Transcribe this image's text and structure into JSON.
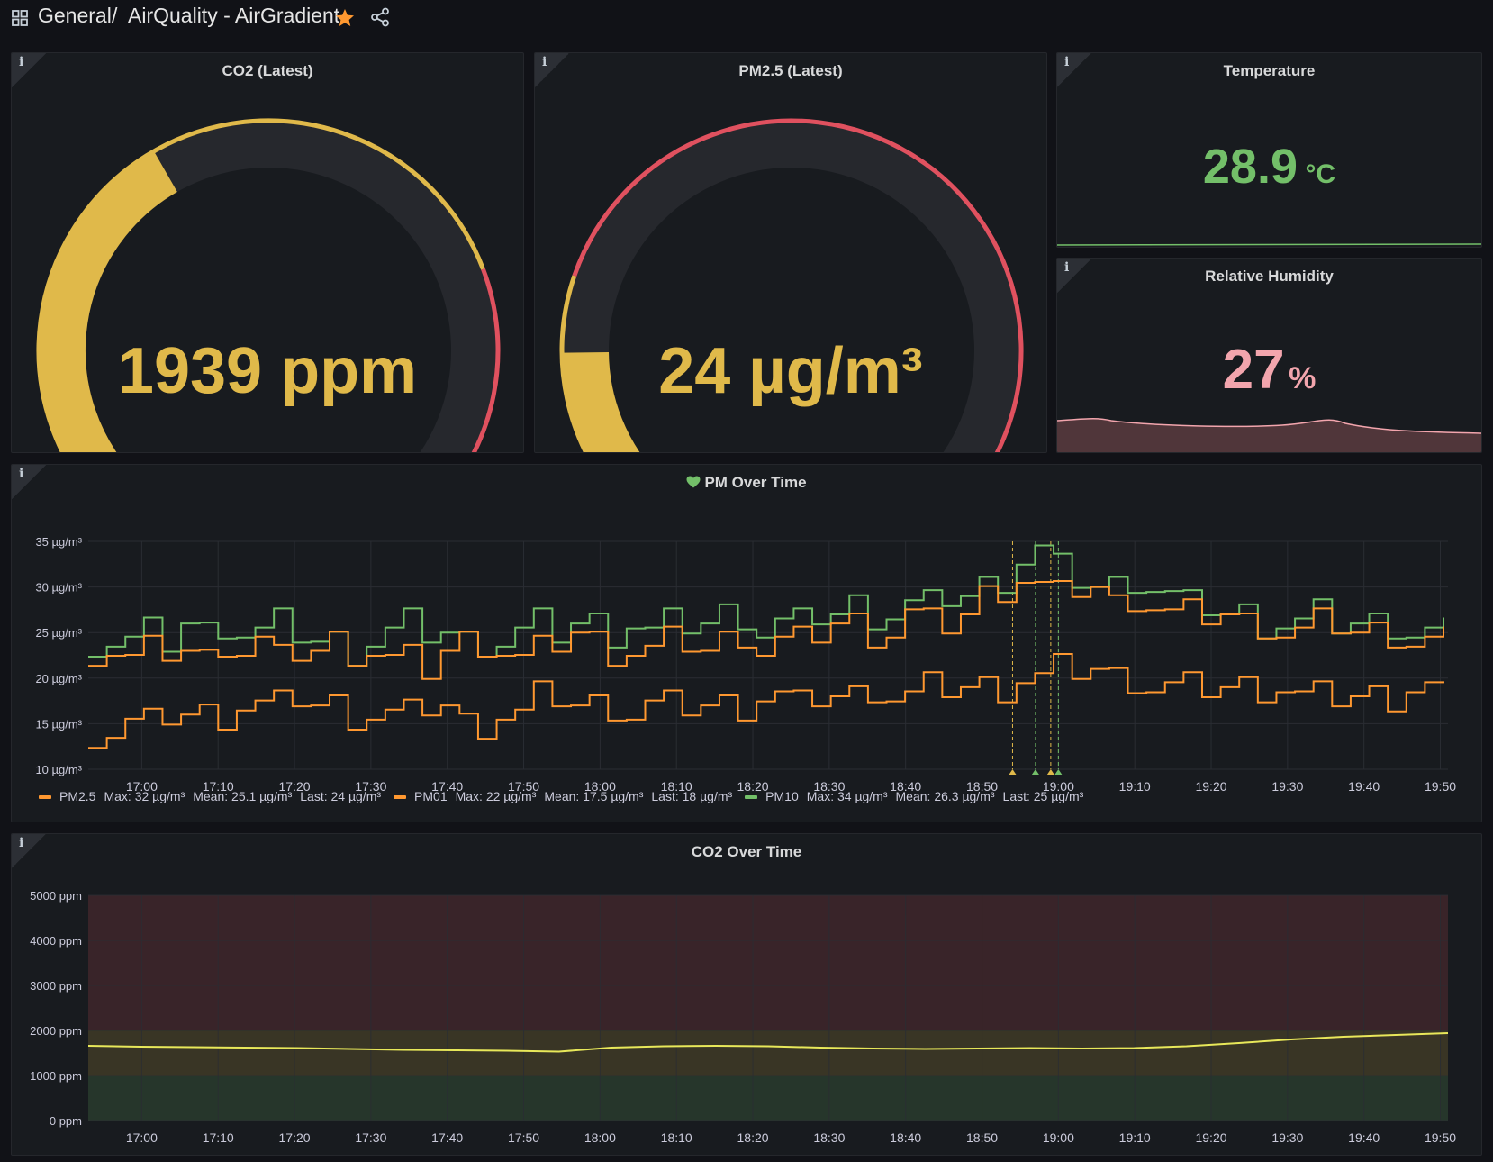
{
  "header": {
    "folder": "General",
    "separator": "/",
    "title": "AirQuality - AirGradient",
    "icons": [
      "apps-grid-icon",
      "star-icon",
      "share-icon"
    ],
    "star_color": "#ff9830"
  },
  "panels": {
    "co2_latest": {
      "title": "CO2 (Latest)",
      "value": "1939 ppm",
      "value_num": 1939,
      "min": 0,
      "max": 5000,
      "thresholds": [
        3800
      ],
      "fill_color": "#e0b94a",
      "threshold_colors": [
        "#e0b94a",
        "#e0515f"
      ]
    },
    "pm25_latest": {
      "title": "PM2.5 (Latest)",
      "value": "24 µg/m³",
      "value_num": 24,
      "min": 0,
      "max": 150,
      "thresholds": [
        35
      ],
      "fill_color": "#e0b94a",
      "threshold_colors": [
        "#e0b94a",
        "#e0515f"
      ]
    },
    "temperature": {
      "title": "Temperature",
      "value": "28.9",
      "unit": "°C",
      "color": "#73bf69"
    },
    "humidity": {
      "title": "Relative Humidity",
      "value": "27",
      "unit": "%",
      "color": "#f2a5ad"
    },
    "pm_over_time": {
      "title": "PM Over Time",
      "title_icon": "heart-icon"
    },
    "co2_over_time": {
      "title": "CO2 Over Time"
    }
  },
  "chart_data": [
    {
      "type": "line",
      "panel": "PM Over Time",
      "x": [
        "17:00",
        "17:10",
        "17:20",
        "17:30",
        "17:40",
        "17:50",
        "18:00",
        "18:10",
        "18:20",
        "18:30",
        "18:40",
        "18:50",
        "19:00",
        "19:10",
        "19:20",
        "19:30",
        "19:40",
        "19:50"
      ],
      "y_ticks": [
        "10 µg/m³",
        "15 µg/m³",
        "20 µg/m³",
        "25 µg/m³",
        "30 µg/m³",
        "35 µg/m³"
      ],
      "ylim": [
        10,
        35
      ],
      "xlim": [
        "16:53",
        "19:51"
      ],
      "grid": true,
      "legend_position": "bottom-left",
      "annotations_near": [
        "18:54",
        "18:57",
        "18:59",
        "19:00"
      ],
      "series": [
        {
          "name": "PM2.5",
          "color": "#ff9830",
          "stats": {
            "max": "Max: 32 µg/m³",
            "mean": "Mean: 25.1 µg/m³",
            "last": "Last: 24 µg/m³"
          },
          "values": [
            23,
            23,
            22,
            23,
            23,
            23,
            22,
            24,
            23,
            24,
            22,
            23,
            23,
            24,
            23,
            23,
            22,
            22,
            21,
            23,
            24,
            24,
            23,
            22,
            23,
            24,
            25,
            24,
            23,
            23,
            23,
            24,
            24,
            23,
            24,
            25,
            23,
            24,
            24,
            25,
            26,
            26,
            25,
            25,
            27,
            26,
            26,
            27,
            29,
            30,
            31,
            30,
            29,
            30,
            30,
            28,
            29,
            28,
            27,
            27,
            27,
            27,
            26,
            26,
            25,
            25,
            26,
            26,
            25,
            25,
            25,
            24,
            24,
            24
          ]
        },
        {
          "name": "PM01",
          "color": "#ff9830",
          "stats": {
            "max": "Max: 22 µg/m³",
            "mean": "Mean: 17.5 µg/m³",
            "last": "Last: 18 µg/m³"
          },
          "values": [
            14,
            14,
            15,
            15,
            16,
            16,
            16,
            16,
            17,
            17,
            17,
            18,
            17,
            17,
            16,
            16,
            16,
            16,
            17,
            17,
            15,
            15,
            16,
            16,
            18,
            18,
            17,
            17,
            17,
            16,
            17,
            17,
            17,
            17,
            17,
            17,
            18,
            18,
            17,
            18,
            18,
            18,
            19,
            18,
            18,
            19,
            19,
            19,
            19,
            19,
            20,
            20,
            21,
            21,
            21,
            20,
            20,
            19,
            19,
            19,
            19,
            19,
            19,
            19,
            19,
            18,
            18,
            18,
            18,
            18,
            18,
            19,
            19,
            18
          ]
        },
        {
          "name": "PM10",
          "color": "#73bf69",
          "stats": {
            "max": "Max: 34 µg/m³",
            "mean": "Mean: 26.3 µg/m³",
            "last": "Last: 25 µg/m³"
          },
          "values": [
            24,
            24,
            24,
            25,
            24,
            26,
            25,
            26,
            25,
            25,
            26,
            25,
            24,
            24,
            23,
            24,
            25,
            26,
            25,
            25,
            24,
            24,
            24,
            25,
            26,
            25,
            26,
            26,
            25,
            26,
            25,
            26,
            26,
            26,
            27,
            27,
            25,
            26,
            26,
            27,
            27,
            28,
            27,
            27,
            28,
            28,
            29,
            29,
            30,
            31,
            33,
            34,
            32,
            31,
            30,
            30,
            31,
            30,
            29,
            28,
            28,
            27,
            27,
            26,
            26,
            26,
            27,
            26,
            26,
            26,
            26,
            25,
            25,
            25
          ]
        }
      ]
    },
    {
      "type": "area",
      "panel": "CO2 Over Time",
      "x": [
        "17:00",
        "17:10",
        "17:20",
        "17:30",
        "17:40",
        "17:50",
        "18:00",
        "18:10",
        "18:20",
        "18:30",
        "18:40",
        "18:50",
        "19:00",
        "19:10",
        "19:20",
        "19:30",
        "19:40",
        "19:50"
      ],
      "y_ticks": [
        "0 ppm",
        "1000 ppm",
        "2000 ppm",
        "3000 ppm",
        "4000 ppm",
        "5000 ppm"
      ],
      "ylim": [
        0,
        5000
      ],
      "xlim": [
        "16:53",
        "19:51"
      ],
      "grid": true,
      "threshold_bands": [
        {
          "from": 0,
          "to": 1000,
          "color": "#73bf69"
        },
        {
          "from": 1000,
          "to": 2000,
          "color": "#e0b94a"
        },
        {
          "from": 2000,
          "to": 5000,
          "color": "#e0515f"
        }
      ],
      "series": [
        {
          "name": "CO2",
          "color": "#e8e85a",
          "values": [
            1660,
            1640,
            1630,
            1620,
            1610,
            1590,
            1570,
            1560,
            1550,
            1530,
            1620,
            1650,
            1660,
            1650,
            1620,
            1600,
            1590,
            1600,
            1610,
            1600,
            1610,
            1650,
            1720,
            1800,
            1860,
            1900,
            1940
          ]
        }
      ]
    }
  ]
}
